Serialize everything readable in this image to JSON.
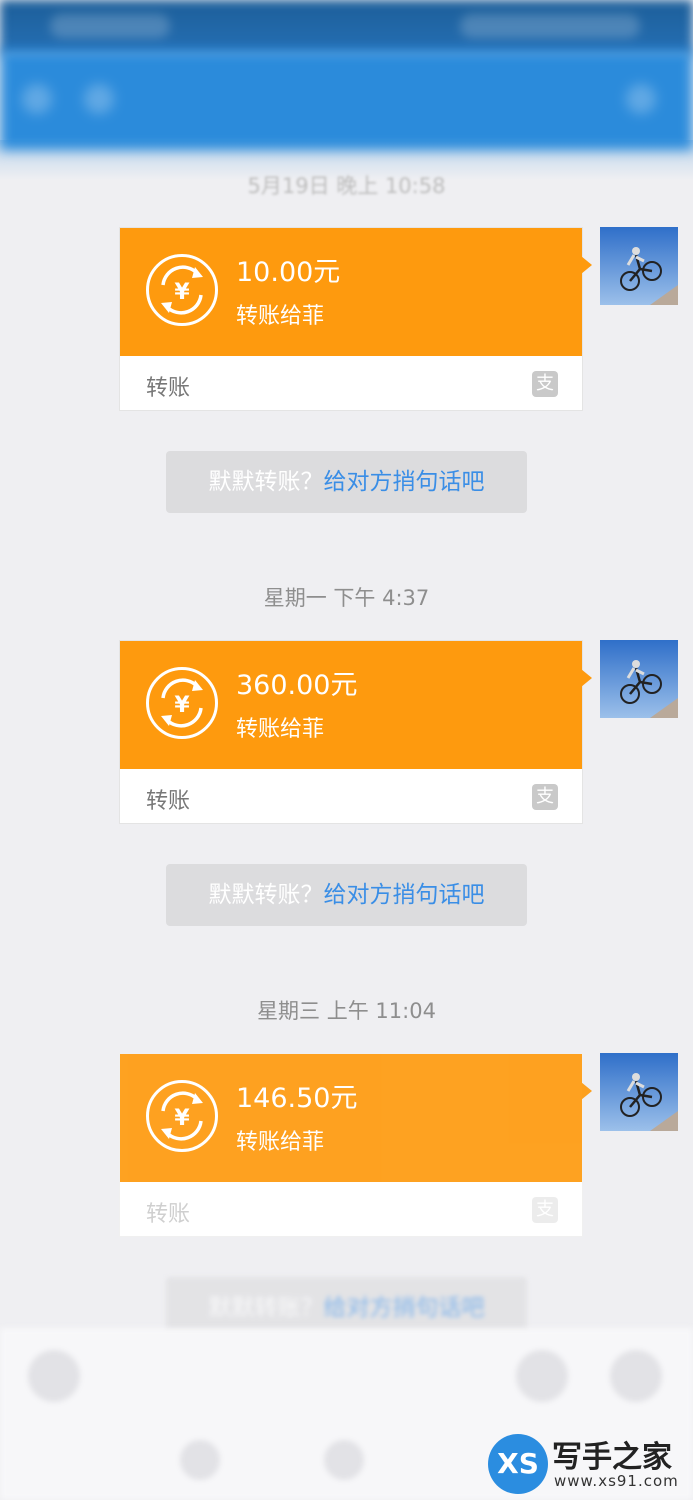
{
  "transfer_label": "转账",
  "recipient_text": "转账给菲",
  "pay_logo_char": "支",
  "hint": {
    "prefix": "默默转账？",
    "link": "给对方捎句话吧"
  },
  "messages": [
    {
      "time": "5月19日 晚上 10:58",
      "amount": "10.00元"
    },
    {
      "time": "星期一 下午 4:37",
      "amount": "360.00元"
    },
    {
      "time": "星期三 上午 11:04",
      "amount": "146.50元"
    }
  ],
  "watermark": {
    "logo": "XS",
    "name": "写手之家",
    "url": "www.xs91.com"
  },
  "colors": {
    "bubble_orange": "#fe9a0e",
    "header_blue": "#2b8bdb",
    "link_blue": "#3a8ee6"
  }
}
